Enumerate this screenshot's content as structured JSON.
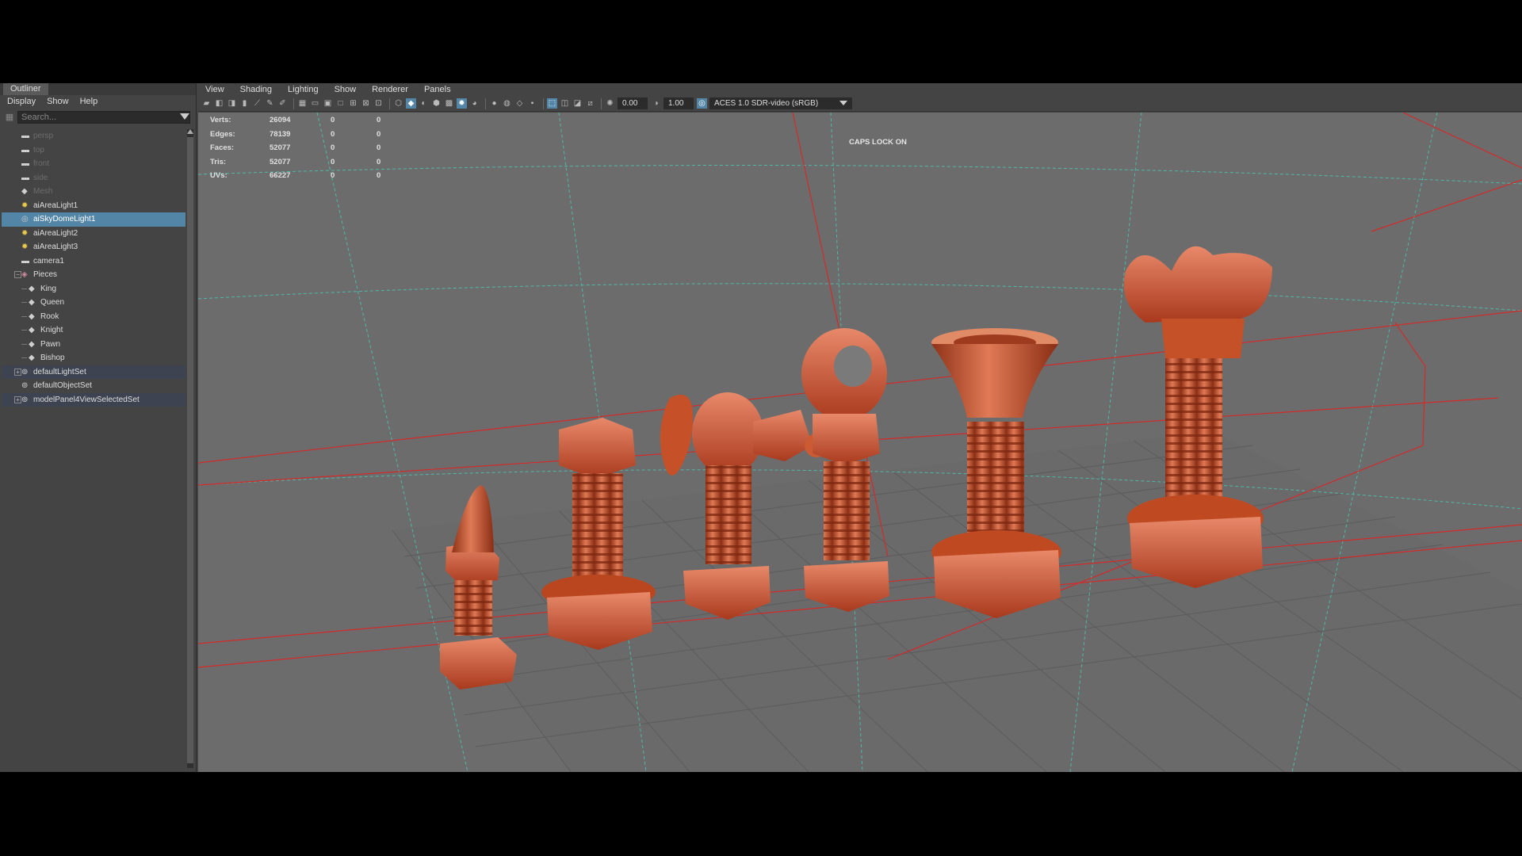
{
  "outliner": {
    "title": "Outliner",
    "menu": [
      "Display",
      "Show",
      "Help"
    ],
    "search_placeholder": "Search...",
    "items": [
      {
        "label": "persp",
        "icon": "camera-icon",
        "dim": true
      },
      {
        "label": "top",
        "icon": "camera-icon",
        "dim": true
      },
      {
        "label": "front",
        "icon": "camera-icon",
        "dim": true
      },
      {
        "label": "side",
        "icon": "camera-icon",
        "dim": true
      },
      {
        "label": "Mesh",
        "icon": "mesh-icon",
        "dim": true
      },
      {
        "label": "aiAreaLight1",
        "icon": "light-icon"
      },
      {
        "label": "aiSkyDomeLight1",
        "icon": "skydome-icon",
        "selected": true
      },
      {
        "label": "aiAreaLight2",
        "icon": "light-icon"
      },
      {
        "label": "aiAreaLight3",
        "icon": "light-icon"
      },
      {
        "label": "camera1",
        "icon": "camera-icon"
      },
      {
        "label": "Pieces",
        "icon": "group-icon",
        "expanded": true
      },
      {
        "label": "King",
        "icon": "mesh-icon",
        "child": true
      },
      {
        "label": "Queen",
        "icon": "mesh-icon",
        "child": true
      },
      {
        "label": "Rook",
        "icon": "mesh-icon",
        "child": true
      },
      {
        "label": "Knight",
        "icon": "mesh-icon",
        "child": true
      },
      {
        "label": "Pawn",
        "icon": "mesh-icon",
        "child": true
      },
      {
        "label": "Bishop",
        "icon": "mesh-icon",
        "child": true
      },
      {
        "label": "defaultLightSet",
        "icon": "set-icon",
        "set": true
      },
      {
        "label": "defaultObjectSet",
        "icon": "set-icon"
      },
      {
        "label": "modelPanel4ViewSelectedSet",
        "icon": "set-icon",
        "set": true
      }
    ]
  },
  "viewport": {
    "menu": [
      "View",
      "Shading",
      "Lighting",
      "Show",
      "Renderer",
      "Panels"
    ],
    "exposure": "0.00",
    "gamma": "1.00",
    "color_space": "ACES 1.0 SDR-video (sRGB)",
    "caps_lock": "CAPS LOCK ON",
    "hud": [
      {
        "label": "Verts:",
        "v1": "26094",
        "v2": "0",
        "v3": "0"
      },
      {
        "label": "Edges:",
        "v1": "78139",
        "v2": "0",
        "v3": "0"
      },
      {
        "label": "Faces:",
        "v1": "52077",
        "v2": "0",
        "v3": "0"
      },
      {
        "label": "Tris:",
        "v1": "52077",
        "v2": "0",
        "v3": "0"
      },
      {
        "label": "UVs:",
        "v1": "66227",
        "v2": "0",
        "v3": "0"
      }
    ],
    "pieces_color": "#c4522d",
    "selection_color": "#d42a2a",
    "grid_color": "#5f5f5f",
    "skydome_grid_color": "#4fb8a8"
  }
}
